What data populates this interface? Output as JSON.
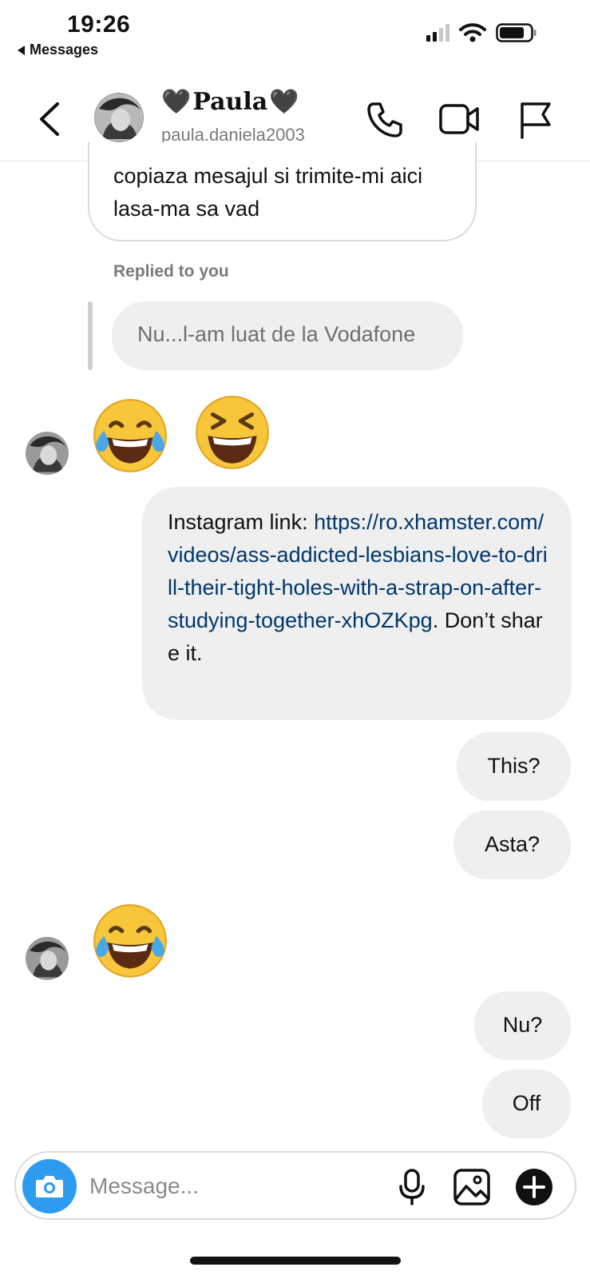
{
  "status_bar": {
    "time": "19:26",
    "back_app": "Messages"
  },
  "header": {
    "name": "Paula",
    "heart_left": "🖤",
    "heart_right": "🖤",
    "username": "paula.daniela2003"
  },
  "messages": {
    "m1_text": "copiaza mesajul si trimite-mi aici lasa-ma sa vad",
    "reply_label": "Replied to you",
    "m2_text": "Nu...l-am luat de la Vodafone",
    "m4_prefix": "Instagram link: ",
    "m4_link": "https://ro.xhamster.com/videos/ass-addicted-lesbians-love-to-drill-their-tight-holes-with-a-strap-on-after-studying-together-xhOZKpg",
    "m4_suffix": ". Don’t share it.",
    "m5_text": "This?",
    "m6_text": "Asta?",
    "m8_text": "Nu?",
    "m9_text": "Off"
  },
  "composer": {
    "placeholder": "Message..."
  },
  "colors": {
    "link": "#00376b",
    "camera_button": "#2d9bf0",
    "bubble_gray": "#efefef",
    "outline": "#dbdbdb"
  },
  "icons": [
    "chevron-left-icon",
    "phone-icon",
    "video-camera-icon",
    "flag-icon",
    "camera-icon",
    "microphone-icon",
    "image-icon",
    "plus-icon",
    "face-with-tears-of-joy-emoji",
    "grinning-squinting-face-emoji"
  ]
}
